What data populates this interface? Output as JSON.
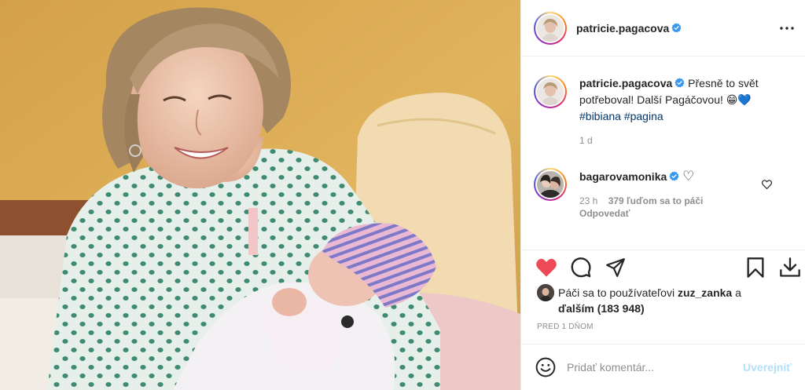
{
  "post": {
    "author": "patricie.pagacova",
    "more_label": "•••"
  },
  "caption": {
    "author": "patricie.pagacova",
    "text": "Přesně to svět potřeboval! Další Pagáčovou!",
    "emoji": "😁",
    "heart": "💙",
    "hashtags": [
      "#bibiana",
      "#pagina"
    ],
    "age": "1 d"
  },
  "comment": {
    "author": "bagarovamonika",
    "heart": "♡",
    "age": "23 h",
    "likes": "379 ľuďom sa to páči",
    "reply_label": "Odpovedať"
  },
  "likes": {
    "prefix": "Páči sa to používateľovi",
    "user": "zuz_zanka",
    "conj": "a",
    "others": "ďalším (183 948)"
  },
  "date_label": "PRED 1 DŇOM",
  "add_comment": {
    "placeholder": "Pridať komentár...",
    "post_label": "Uverejniť"
  },
  "colors": {
    "like_red": "#ed4956",
    "verified_blue": "#3897f0",
    "link": "#00376b",
    "muted": "#8e8e8e",
    "post_disabled": "#b2dffc"
  },
  "icons": {
    "like": "heart-icon",
    "comment": "comment-icon",
    "share": "share-icon",
    "save": "bookmark-icon",
    "download": "download-icon",
    "emoji": "emoji-icon",
    "more": "more-icon",
    "verified": "verified-badge-icon"
  }
}
